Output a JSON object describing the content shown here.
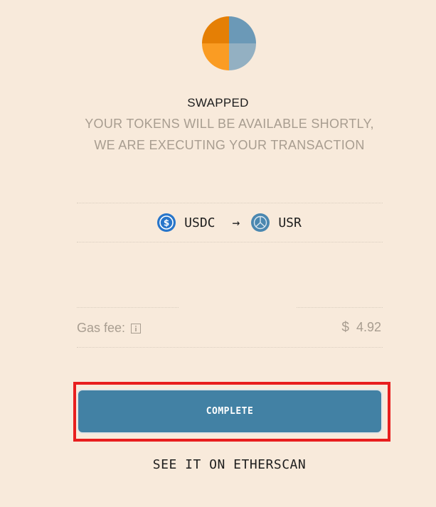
{
  "logo": {
    "icon": "swap-pie-logo-icon",
    "colors": {
      "top_left": "#e57f05",
      "top_right": "#6b99b7",
      "bottom_left": "#fa9c23",
      "bottom_right": "#93b0c2"
    }
  },
  "status": {
    "title": "SWAPPED",
    "subtitle_line1": "YOUR TOKENS WILL BE AVAILABLE SHORTLY,",
    "subtitle_line2": "WE ARE EXECUTING YOUR TRANSACTION"
  },
  "swap": {
    "from_token": {
      "symbol": "USDC",
      "icon": "usdc-icon",
      "color": "#2775ca"
    },
    "arrow": "→",
    "to_token": {
      "symbol": "USR",
      "icon": "usr-icon",
      "color": "#4a87b0"
    }
  },
  "gas": {
    "label": "Gas fee:",
    "icon": "info-icon",
    "currency": "$",
    "value": "4.92"
  },
  "actions": {
    "complete_label": "COMPLETE",
    "etherscan_label": "SEE IT ON ETHERSCAN"
  },
  "colors": {
    "background": "#f8eadb",
    "button": "#4281a4",
    "highlight": "#e81e1e",
    "muted_text": "#a89d90"
  }
}
